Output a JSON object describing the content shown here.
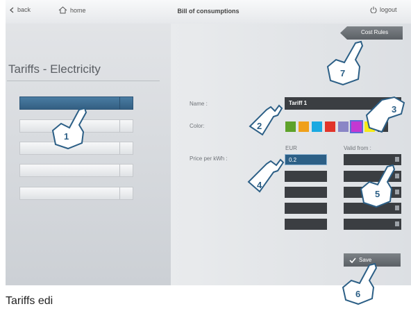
{
  "topbar": {
    "back_label": "back",
    "home_label": "home",
    "title": "Bill of consumptions",
    "logout_label": "logout"
  },
  "cost_rules_label": "Cost Rules",
  "heading": "Tariffs - Electricity",
  "tariff_slots": [
    {
      "active": true
    },
    {
      "active": false
    },
    {
      "active": false
    },
    {
      "active": false
    },
    {
      "active": false
    }
  ],
  "labels": {
    "name": "Name :",
    "color": "Color:",
    "price": "Price per kWh :",
    "currency": "EUR",
    "valid_from": "Valid from :"
  },
  "name_value": "Tariff 1",
  "colors": [
    "#5ea22a",
    "#f0a01b",
    "#1aa9e1",
    "#e2342a",
    "#8a86c6",
    "#c338d2",
    "#f7ea17",
    "#3b3e42"
  ],
  "selected_color_index": 5,
  "price_values": [
    "0.2",
    "",
    "",
    "",
    ""
  ],
  "save_label": "Save",
  "callouts": [
    "1",
    "2",
    "3",
    "4",
    "5",
    "6",
    "7"
  ],
  "caption": "Tariffs edi"
}
